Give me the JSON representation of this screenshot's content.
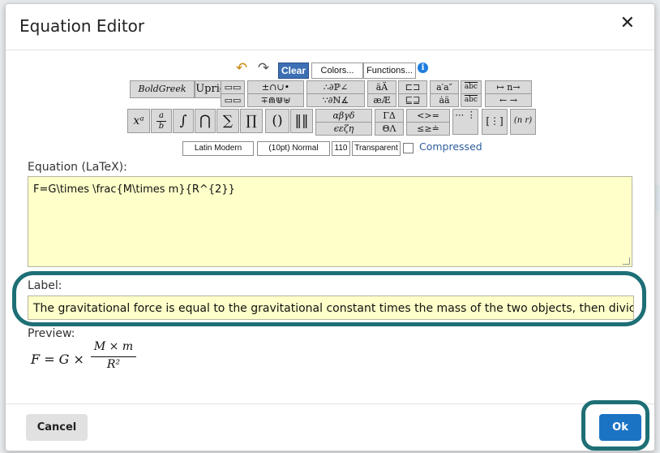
{
  "dialog": {
    "title": "Equation Editor",
    "close_glyph": "✕"
  },
  "toolbar": {
    "undo_icon": "undo-icon",
    "redo_icon": "redo-icon",
    "clear": "Clear",
    "colors": "Colors...",
    "functions": "Functions...",
    "info": "i"
  },
  "palette": {
    "boldgreek": "BoldGreek",
    "upright": "Upright",
    "boxes_a": "▭▭",
    "boxes_b": "▭▭",
    "ops_a": "±∩∪•",
    "ops_b": "∓⋒⋓⊎",
    "dots_a": "∴∂ℙ∠",
    "dots_b": "∵∂ℕ∡",
    "accents_a": "äÄ",
    "accents_b": "æÆ",
    "brackets_a": "⊏⊐",
    "brackets_b": "⊑⊒",
    "primes_a": "a′a″",
    "primes_b": "ȧä",
    "abc_a": "abc",
    "abc_b": "abc",
    "arrows_a": "↦ n→",
    "arrows_b": "← →",
    "sup": "xᵃ",
    "frac_num": "a",
    "frac_den": "b",
    "integral": "∫",
    "bigcap": "⋂",
    "sum": "∑",
    "prod": "∏",
    "paren": "()",
    "norm": "‖‖",
    "greek_a": "αβγδ",
    "greek_b": "ϵεζη",
    "greekcap_a": "ΓΔ",
    "greekcap_b": "ΘΛ",
    "rel_a": "<>=",
    "rel_b": "≤≥≐",
    "matrix_dots": "⋯ ⋮",
    "matrix": "[⋮]",
    "binom": "(n r)"
  },
  "fontbar": {
    "font": "Latin Modern",
    "size": "(10pt) Normal",
    "dpi": "110",
    "background": "Transparent",
    "compressed": "Compressed"
  },
  "latex": {
    "label": "Equation (LaTeX):",
    "value": "F=G\\times \\frac{M\\times m}{R^{2}}"
  },
  "label_field": {
    "label": "Label:",
    "value": "The gravitational force is equal to the gravitational constant times the mass of the two objects, then divic"
  },
  "preview": {
    "label": "Preview:",
    "lhs": "F = G ×",
    "numerator": "M × m",
    "denominator": "R²"
  },
  "footer": {
    "cancel": "Cancel",
    "ok": "Ok"
  }
}
